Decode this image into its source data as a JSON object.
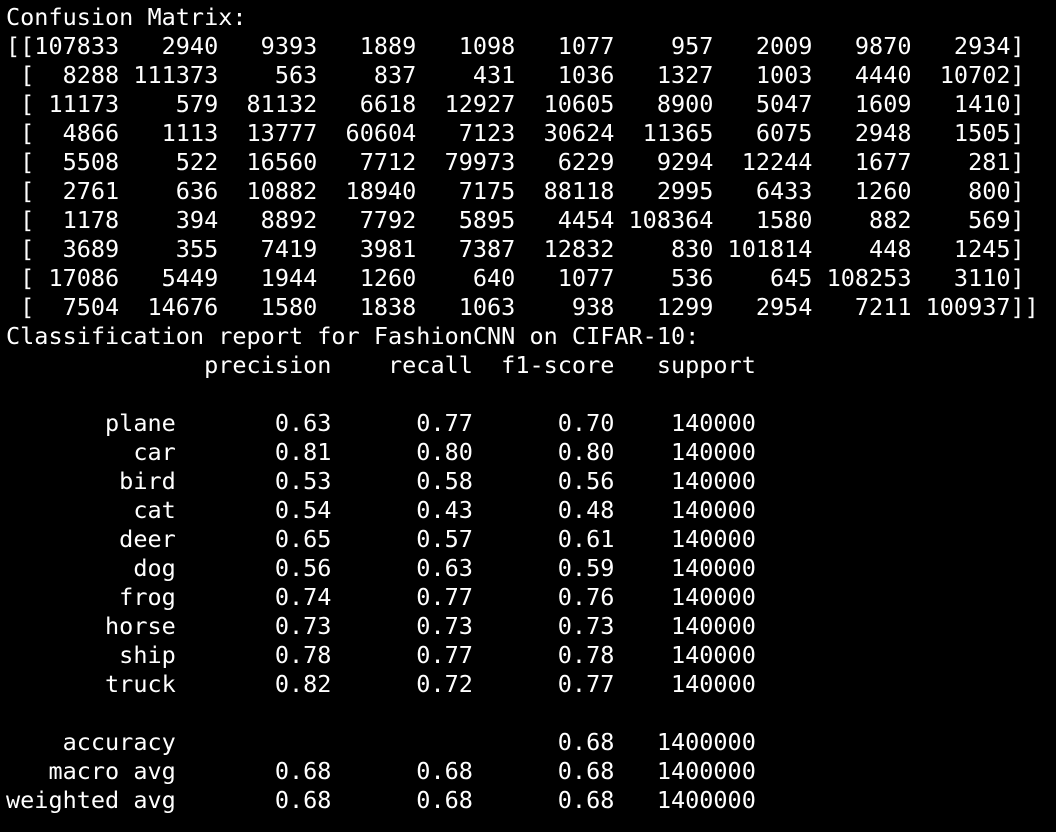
{
  "theme": {
    "background": "#000000",
    "foreground": "#ffffff"
  },
  "terminal": {
    "lines": [
      "Confusion Matrix:",
      "[[107833   2940   9393   1889   1098   1077    957   2009   9870   2934]",
      " [  8288 111373    563    837    431   1036   1327   1003   4440  10702]",
      " [ 11173    579  81132   6618  12927  10605   8900   5047   1609   1410]",
      " [  4866   1113  13777  60604   7123  30624  11365   6075   2948   1505]",
      " [  5508    522  16560   7712  79973   6229   9294  12244   1677    281]",
      " [  2761    636  10882  18940   7175  88118   2995   6433   1260    800]",
      " [  1178    394   8892   7792   5895   4454 108364   1580    882    569]",
      " [  3689    355   7419   3981   7387  12832    830 101814    448   1245]",
      " [ 17086   5449   1944   1260    640   1077    536    645 108253   3110]",
      " [  7504  14676   1580   1838   1063    938   1299   2954   7211 100937]]",
      "Classification report for FashionCNN on CIFAR-10:",
      "              precision    recall  f1-score   support",
      "",
      "       plane       0.63      0.77      0.70    140000",
      "         car       0.81      0.80      0.80    140000",
      "        bird       0.53      0.58      0.56    140000",
      "         cat       0.54      0.43      0.48    140000",
      "        deer       0.65      0.57      0.61    140000",
      "         dog       0.56      0.63      0.59    140000",
      "        frog       0.74      0.77      0.76    140000",
      "       horse       0.73      0.73      0.73    140000",
      "        ship       0.78      0.77      0.78    140000",
      "       truck       0.82      0.72      0.77    140000",
      "",
      "    accuracy                           0.68   1400000",
      "   macro avg       0.68      0.68      0.68   1400000",
      "weighted avg       0.68      0.68      0.68   1400000"
    ]
  }
}
